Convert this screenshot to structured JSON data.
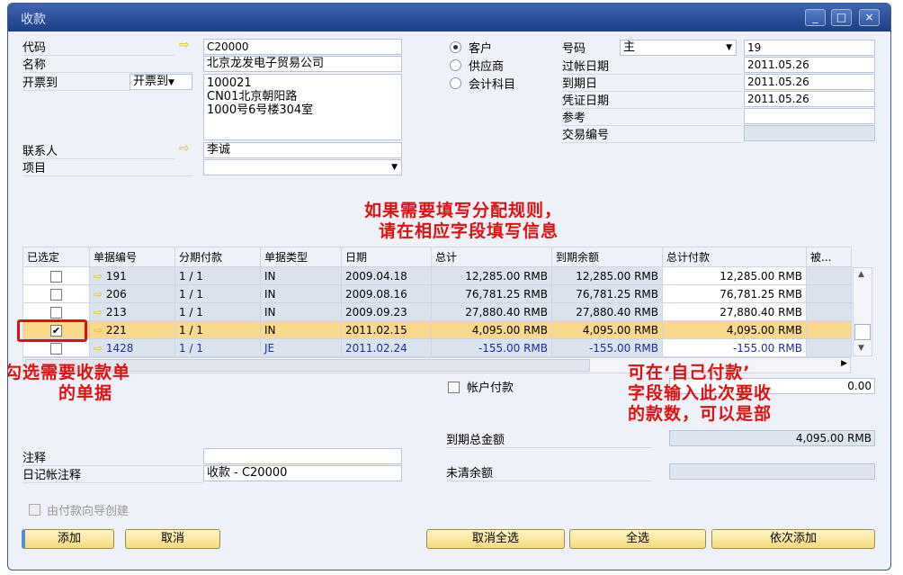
{
  "window": {
    "title": "收款",
    "minimize": "_",
    "maximize": "□",
    "close": "×"
  },
  "header": {
    "code_label": "代码",
    "code_value": "C20000",
    "name_label": "名称",
    "name_value": "北京龙发电子贸易公司",
    "billto_label": "开票到",
    "billto_select": "开票到",
    "billto_address": "100021\nCN01北京朝阳路\n1000号6号楼304室",
    "contact_label": "联系人",
    "contact_value": "李诚",
    "project_label": "项目",
    "project_value": "",
    "radios": [
      {
        "label": "客户",
        "checked": true
      },
      {
        "label": "供应商",
        "checked": false
      },
      {
        "label": "会计科目",
        "checked": false
      }
    ],
    "number_label": "号码",
    "series_value": "主",
    "number_value": "19",
    "posting_date_label": "过帐日期",
    "posting_date": "2011.05.26",
    "due_date_label": "到期日",
    "due_date": "2011.05.26",
    "doc_date_label": "凭证日期",
    "doc_date": "2011.05.26",
    "reference_label": "参考",
    "reference_value": "",
    "trans_no_label": "交易编号",
    "trans_no_value": ""
  },
  "annotations": {
    "top1": "如果需要填写分配规则，",
    "top2": "请在相应字段填写信息",
    "left1": "勾选需要收款单",
    "left2": "的单据",
    "right1": "可在‘自己付款’",
    "right2": "字段输入此次要收",
    "right3": "的款数，可以是部"
  },
  "table": {
    "columns": [
      "已选定",
      "单据编号",
      "分期付款",
      "单据类型",
      "日期",
      "总计",
      "到期余额",
      "总计付款",
      "被..."
    ],
    "rows": [
      {
        "selected": false,
        "doc_no": "191",
        "installment": "1 / 1",
        "type": "IN",
        "date": "2009.04.18",
        "total": "12,285.00 RMB",
        "balance_due": "12,285.00 RMB",
        "total_payment": "12,285.00 RMB"
      },
      {
        "selected": false,
        "doc_no": "206",
        "installment": "1 / 1",
        "type": "IN",
        "date": "2009.08.16",
        "total": "76,781.25 RMB",
        "balance_due": "76,781.25 RMB",
        "total_payment": "76,781.25 RMB"
      },
      {
        "selected": false,
        "doc_no": "213",
        "installment": "1 / 1",
        "type": "IN",
        "date": "2009.09.23",
        "total": "27,880.40 RMB",
        "balance_due": "27,880.40 RMB",
        "total_payment": "27,880.40 RMB"
      },
      {
        "selected": true,
        "doc_no": "221",
        "installment": "1 / 1",
        "type": "IN",
        "date": "2011.02.15",
        "total": "4,095.00 RMB",
        "balance_due": "4,095.00 RMB",
        "total_payment": "4,095.00 RMB"
      },
      {
        "selected": false,
        "doc_no": "1428",
        "installment": "1 / 1",
        "type": "JE",
        "date": "2011.02.24",
        "total": "-155.00 RMB",
        "balance_due": "-155.00 RMB",
        "total_payment": "-155.00 RMB"
      }
    ]
  },
  "footer": {
    "account_payment_label": "帐户付款",
    "account_payment_value": "0.00",
    "total_due_label": "到期总金额",
    "total_due_value": "4,095.00 RMB",
    "open_balance_label": "未清余额",
    "open_balance_value": "",
    "remarks_label": "注释",
    "remarks_value": "",
    "journal_label": "日记帐注释",
    "journal_value": "收款 - C20000",
    "wizard_label": "由付款向导创建"
  },
  "buttons": {
    "add": "添加",
    "cancel": "取消",
    "deselect_all": "取消全选",
    "select_all": "全选",
    "add_in_sequence": "依次添加"
  }
}
